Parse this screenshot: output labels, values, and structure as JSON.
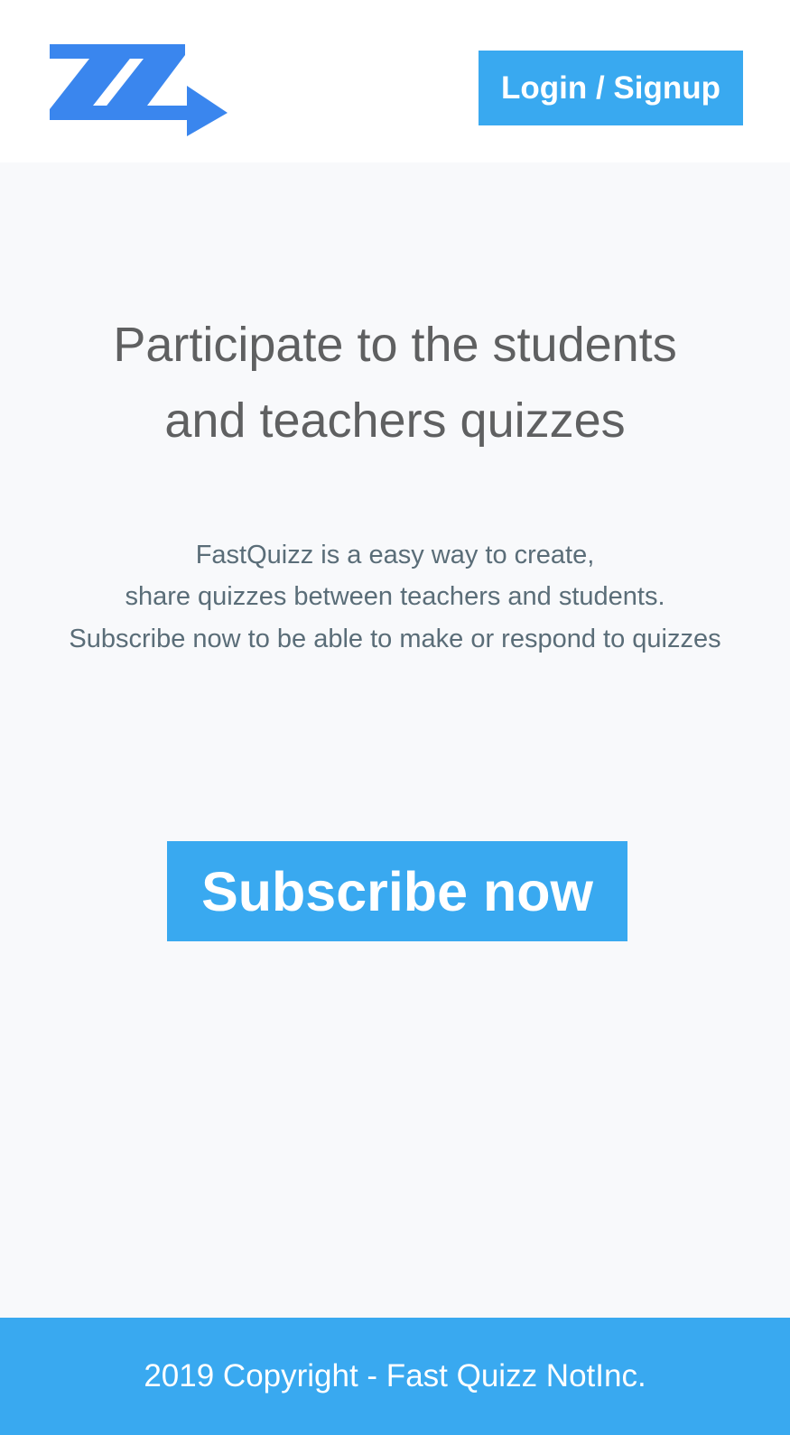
{
  "header": {
    "logo_icon": "fastquizz-zz-arrow-logo",
    "login_label": "Login / Signup"
  },
  "hero": {
    "headline_line1": "Participate to the students",
    "headline_line2": "and teachers quizzes",
    "description_line1": "FastQuizz is a easy way to create,",
    "description_line2": "share quizzes between teachers and students.",
    "cta_text": "Subscribe now to be able to make or respond to quizzes",
    "subscribe_label": "Subscribe now"
  },
  "footer": {
    "copyright": "2019 Copyright - Fast Quizz NotInc."
  },
  "colors": {
    "accent": "#39a9f0",
    "logo": "#3a86ee",
    "heading": "#5f6061",
    "body_text": "#5a6d78",
    "background": "#f8f9fb",
    "header_bg": "#ffffff"
  }
}
